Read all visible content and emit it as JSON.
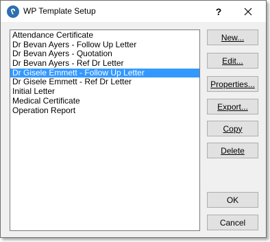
{
  "window": {
    "title": "WP Template Setup",
    "help_label": "?"
  },
  "templates": {
    "items": [
      "Attendance Certificate",
      "Dr Bevan Ayers - Follow Up Letter",
      "Dr Bevan Ayers - Quotation",
      "Dr Bevan Ayers - Ref Dr Letter",
      "Dr Gisele Emmett - Follow Up Letter",
      "Dr Gisele Emmett - Ref Dr Letter",
      "Initial Letter",
      "Medical Certificate",
      "Operation Report"
    ],
    "selected_index": 4
  },
  "buttons": {
    "new": "New...",
    "edit": "Edit...",
    "properties": "Properties...",
    "export": "Export...",
    "copy": "Copy",
    "delete": "Delete",
    "ok": "OK",
    "cancel": "Cancel"
  },
  "colors": {
    "selection": "#3399ff",
    "app_icon": "#2d6fb0"
  }
}
